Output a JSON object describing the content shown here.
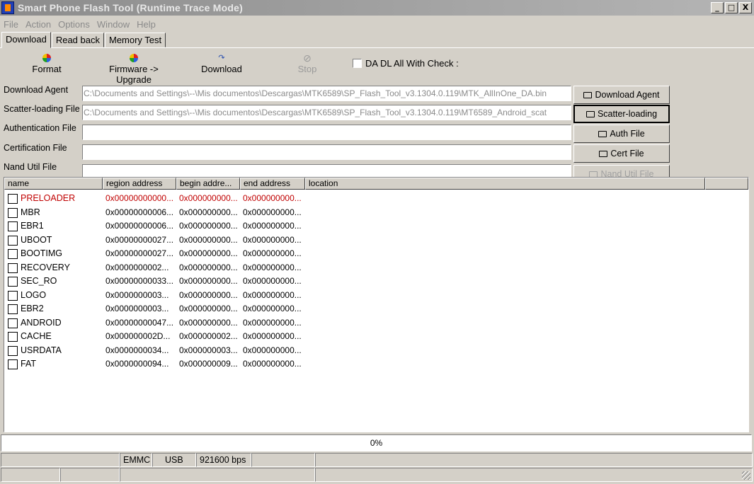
{
  "window": {
    "title": "Smart Phone Flash Tool (Runtime Trace Mode)",
    "controls": [
      "_",
      "□",
      "X"
    ]
  },
  "menu": [
    "File",
    "Action",
    "Options",
    "Window",
    "Help"
  ],
  "tabs": [
    "Download",
    "Read back",
    "Memory Test"
  ],
  "toolbar": {
    "format": "Format",
    "firmware_upgrade": "Firmware -> Upgrade",
    "download": "Download",
    "stop": "Stop",
    "da_dl_check": "DA DL All With Check :"
  },
  "files": {
    "download_agent": {
      "label": "Download Agent",
      "path": "C:\\Documents and Settings\\--\\Mis documentos\\Descargas\\MTK6589\\SP_Flash_Tool_v3.1304.0.119\\MTK_AllInOne_DA.bin",
      "button": "Download Agent"
    },
    "scatter": {
      "label": "Scatter-loading File",
      "path": "C:\\Documents and Settings\\--\\Mis documentos\\Descargas\\MTK6589\\SP_Flash_Tool_v3.1304.0.119\\MT6589_Android_scat",
      "button": "Scatter-loading"
    },
    "auth": {
      "label": "Authentication File",
      "path": "",
      "button": "Auth File"
    },
    "cert": {
      "label": "Certification File",
      "path": "",
      "button": "Cert File"
    },
    "nand": {
      "label": "Nand Util File",
      "path": "",
      "button": "Nand Util File"
    }
  },
  "table": {
    "columns": [
      "name",
      "region address",
      "begin addre...",
      "end address",
      "location"
    ],
    "rows": [
      {
        "name": "PRELOADER",
        "region": "0x00000000000...",
        "begin": "0x000000000...",
        "end": "0x000000000..."
      },
      {
        "name": "MBR",
        "region": "0x00000000006...",
        "begin": "0x000000000...",
        "end": "0x000000000..."
      },
      {
        "name": "EBR1",
        "region": "0x00000000006...",
        "begin": "0x000000000...",
        "end": "0x000000000..."
      },
      {
        "name": "UBOOT",
        "region": "0x00000000027...",
        "begin": "0x000000000...",
        "end": "0x000000000..."
      },
      {
        "name": "BOOTIMG",
        "region": "0x00000000027...",
        "begin": "0x000000000...",
        "end": "0x000000000..."
      },
      {
        "name": "RECOVERY",
        "region": "0x0000000002...",
        "begin": "0x000000000...",
        "end": "0x000000000..."
      },
      {
        "name": "SEC_RO",
        "region": "0x00000000033...",
        "begin": "0x000000000...",
        "end": "0x000000000..."
      },
      {
        "name": "LOGO",
        "region": "0x0000000003...",
        "begin": "0x000000000...",
        "end": "0x000000000..."
      },
      {
        "name": "EBR2",
        "region": "0x0000000003...",
        "begin": "0x000000000...",
        "end": "0x000000000..."
      },
      {
        "name": "ANDROID",
        "region": "0x00000000047...",
        "begin": "0x000000000...",
        "end": "0x000000000..."
      },
      {
        "name": "CACHE",
        "region": "0x000000002D...",
        "begin": "0x000000002...",
        "end": "0x000000000..."
      },
      {
        "name": "USRDATA",
        "region": "0x0000000034...",
        "begin": "0x000000003...",
        "end": "0x000000000..."
      },
      {
        "name": "FAT",
        "region": "0x0000000094...",
        "begin": "0x000000009...",
        "end": "0x000000000..."
      }
    ]
  },
  "progress": {
    "value": 0,
    "text": "0%"
  },
  "status": {
    "storage": "EMMC",
    "port": "USB",
    "baud": "921600 bps"
  },
  "colors": {
    "highlight_row": "#c00000",
    "title_bar": "#8c8c8c",
    "face": "#d4d0c8"
  }
}
